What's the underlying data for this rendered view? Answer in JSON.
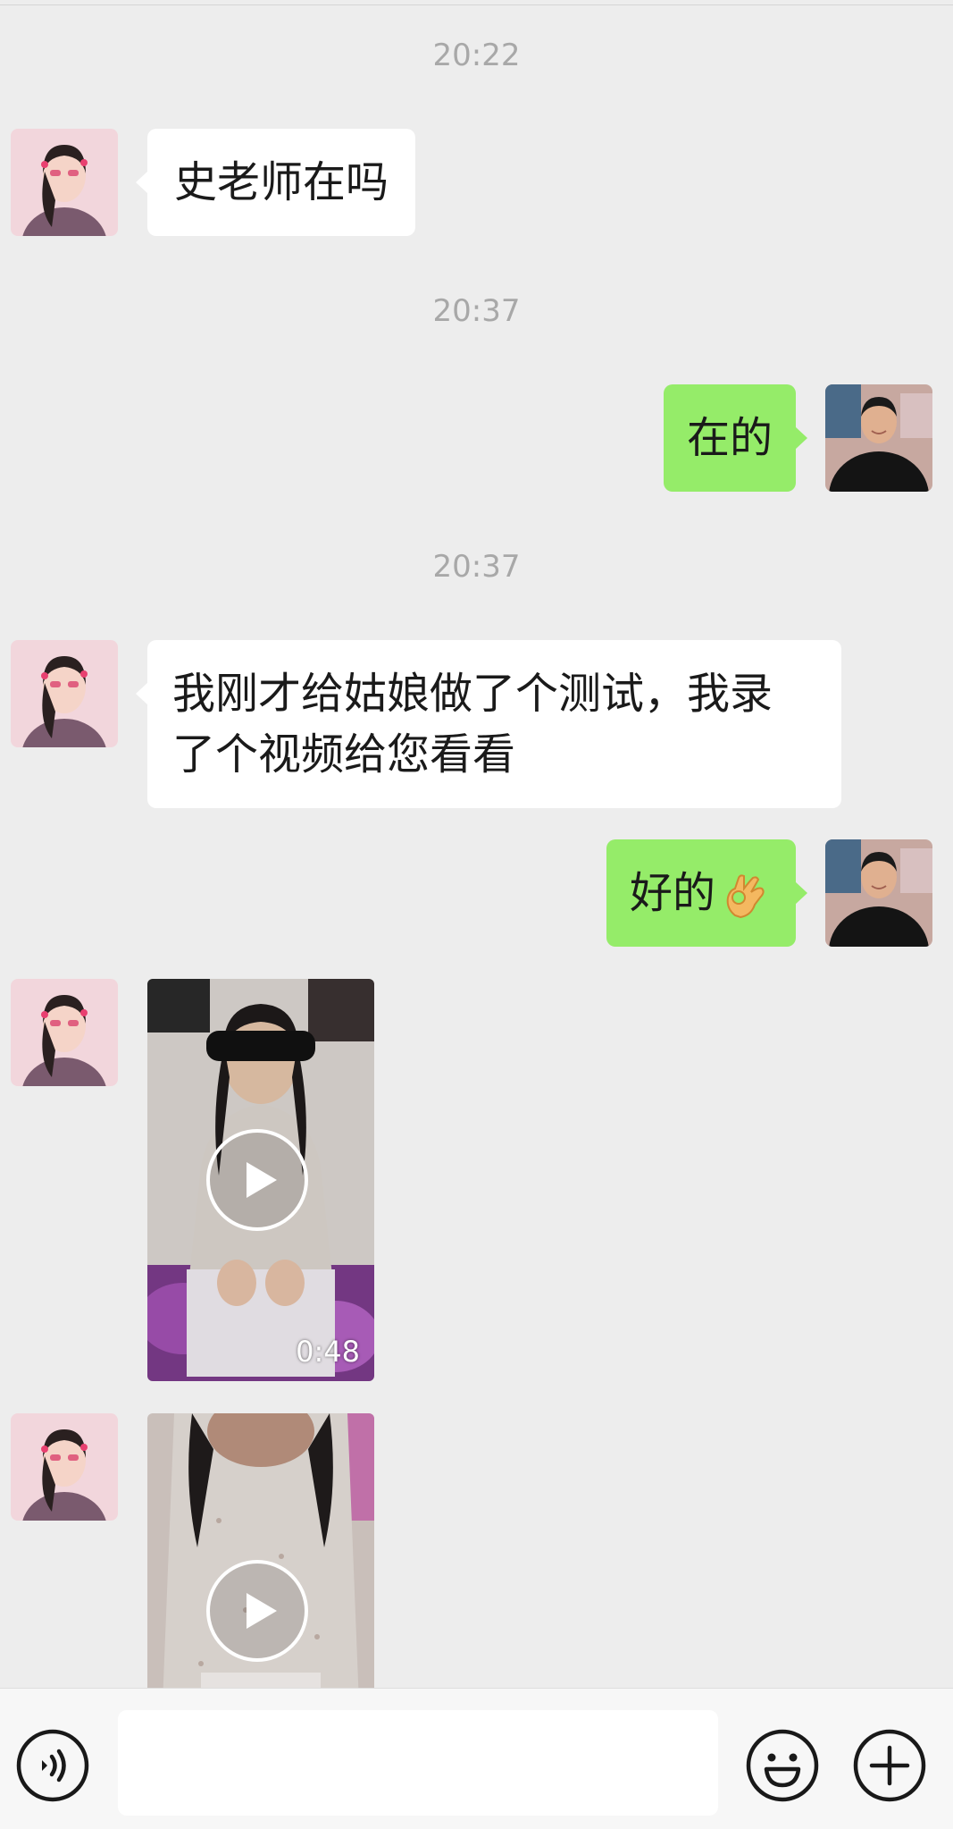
{
  "messages": [
    {
      "type": "time",
      "text": "20:22"
    },
    {
      "type": "text",
      "direction": "incoming",
      "text": "史老师在吗"
    },
    {
      "type": "time",
      "text": "20:37"
    },
    {
      "type": "text",
      "direction": "outgoing",
      "text": "在的"
    },
    {
      "type": "time",
      "text": "20:37"
    },
    {
      "type": "text",
      "direction": "incoming",
      "lines": [
        "我刚才给姑娘做了个测试，我录",
        "了个视频给您看看"
      ]
    },
    {
      "type": "text",
      "direction": "outgoing",
      "text": "好的",
      "emoji": "ok-hand-emoji"
    },
    {
      "type": "video",
      "direction": "incoming",
      "duration": "0:48"
    },
    {
      "type": "video",
      "direction": "incoming"
    }
  ],
  "input_bar": {
    "left_icon": "voice-icon",
    "text_value": "",
    "emoji_icon": "smiley-icon",
    "plus_icon": "plus-icon"
  },
  "colors": {
    "background": "#ededed",
    "incoming_bubble": "#ffffff",
    "outgoing_bubble": "#95ec69",
    "timestamp": "#a8a8a8"
  }
}
